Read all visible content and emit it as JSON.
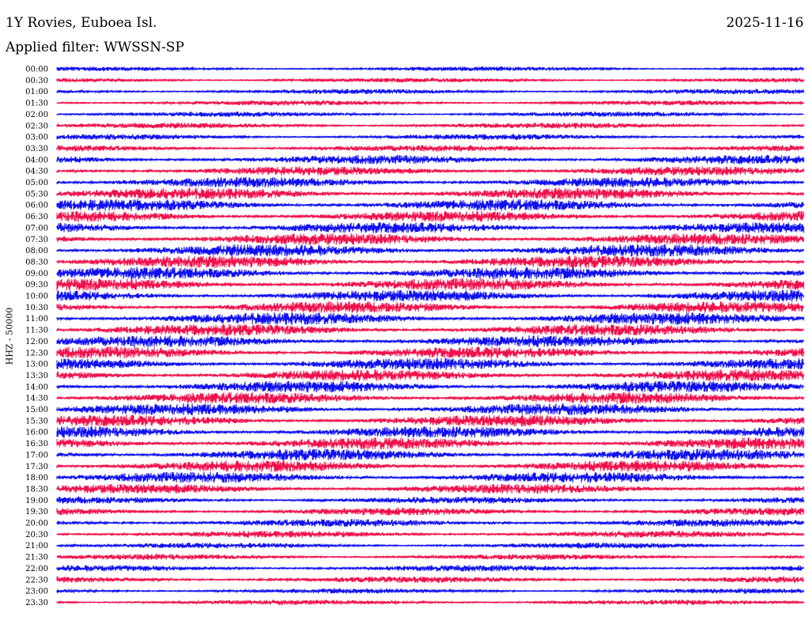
{
  "header": {
    "station": "1Y Rovies, Euboea Isl.",
    "filter": "Applied filter: WWSSN-SP",
    "date": "2025-11-16"
  },
  "chart_data": {
    "type": "line",
    "title": "1Y Rovies, Euboea Isl.",
    "subtitle": "Applied filter: WWSSN-SP",
    "ylabel": "HHZ - 50000",
    "xlabel": "",
    "rows": [
      "00:00",
      "00:30",
      "01:00",
      "01:30",
      "02:00",
      "02:30",
      "03:00",
      "03:30",
      "04:00",
      "04:30",
      "05:00",
      "05:30",
      "06:00",
      "06:30",
      "07:00",
      "07:30",
      "08:00",
      "08:30",
      "09:00",
      "09:30",
      "10:00",
      "10:30",
      "11:00",
      "11:30",
      "12:00",
      "12:30",
      "13:00",
      "13:30",
      "14:00",
      "14:30",
      "15:00",
      "15:30",
      "16:00",
      "16:30",
      "17:00",
      "17:30",
      "18:00",
      "18:30",
      "19:00",
      "19:30",
      "20:00",
      "20:30",
      "21:00",
      "21:30",
      "22:00",
      "22:30",
      "23:00",
      "23:30"
    ],
    "colors": [
      "#1010f0",
      "#f0104c"
    ],
    "row_intensity": [
      0.35,
      0.35,
      0.4,
      0.4,
      0.4,
      0.45,
      0.45,
      0.5,
      0.7,
      0.7,
      0.8,
      0.9,
      0.9,
      0.85,
      0.85,
      0.9,
      0.95,
      0.95,
      0.95,
      0.95,
      0.9,
      0.9,
      0.95,
      0.9,
      0.9,
      0.9,
      0.9,
      0.9,
      0.9,
      0.9,
      0.9,
      0.9,
      0.9,
      0.9,
      0.9,
      0.9,
      0.85,
      0.75,
      0.55,
      0.6,
      0.6,
      0.55,
      0.45,
      0.45,
      0.5,
      0.5,
      0.4,
      0.4
    ]
  }
}
